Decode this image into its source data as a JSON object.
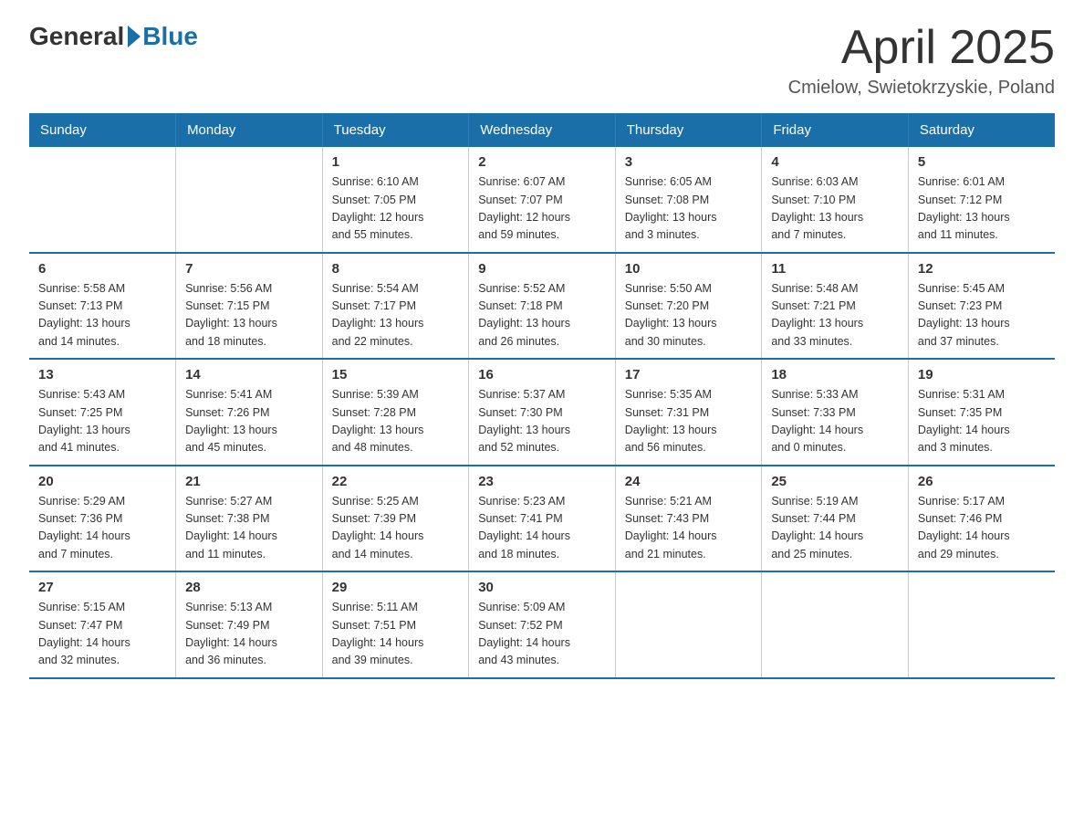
{
  "header": {
    "logo_general": "General",
    "logo_blue": "Blue",
    "month_title": "April 2025",
    "location": "Cmielow, Swietokrzyskie, Poland"
  },
  "weekdays": [
    "Sunday",
    "Monday",
    "Tuesday",
    "Wednesday",
    "Thursday",
    "Friday",
    "Saturday"
  ],
  "weeks": [
    [
      {
        "day": "",
        "info": ""
      },
      {
        "day": "",
        "info": ""
      },
      {
        "day": "1",
        "info": "Sunrise: 6:10 AM\nSunset: 7:05 PM\nDaylight: 12 hours\nand 55 minutes."
      },
      {
        "day": "2",
        "info": "Sunrise: 6:07 AM\nSunset: 7:07 PM\nDaylight: 12 hours\nand 59 minutes."
      },
      {
        "day": "3",
        "info": "Sunrise: 6:05 AM\nSunset: 7:08 PM\nDaylight: 13 hours\nand 3 minutes."
      },
      {
        "day": "4",
        "info": "Sunrise: 6:03 AM\nSunset: 7:10 PM\nDaylight: 13 hours\nand 7 minutes."
      },
      {
        "day": "5",
        "info": "Sunrise: 6:01 AM\nSunset: 7:12 PM\nDaylight: 13 hours\nand 11 minutes."
      }
    ],
    [
      {
        "day": "6",
        "info": "Sunrise: 5:58 AM\nSunset: 7:13 PM\nDaylight: 13 hours\nand 14 minutes."
      },
      {
        "day": "7",
        "info": "Sunrise: 5:56 AM\nSunset: 7:15 PM\nDaylight: 13 hours\nand 18 minutes."
      },
      {
        "day": "8",
        "info": "Sunrise: 5:54 AM\nSunset: 7:17 PM\nDaylight: 13 hours\nand 22 minutes."
      },
      {
        "day": "9",
        "info": "Sunrise: 5:52 AM\nSunset: 7:18 PM\nDaylight: 13 hours\nand 26 minutes."
      },
      {
        "day": "10",
        "info": "Sunrise: 5:50 AM\nSunset: 7:20 PM\nDaylight: 13 hours\nand 30 minutes."
      },
      {
        "day": "11",
        "info": "Sunrise: 5:48 AM\nSunset: 7:21 PM\nDaylight: 13 hours\nand 33 minutes."
      },
      {
        "day": "12",
        "info": "Sunrise: 5:45 AM\nSunset: 7:23 PM\nDaylight: 13 hours\nand 37 minutes."
      }
    ],
    [
      {
        "day": "13",
        "info": "Sunrise: 5:43 AM\nSunset: 7:25 PM\nDaylight: 13 hours\nand 41 minutes."
      },
      {
        "day": "14",
        "info": "Sunrise: 5:41 AM\nSunset: 7:26 PM\nDaylight: 13 hours\nand 45 minutes."
      },
      {
        "day": "15",
        "info": "Sunrise: 5:39 AM\nSunset: 7:28 PM\nDaylight: 13 hours\nand 48 minutes."
      },
      {
        "day": "16",
        "info": "Sunrise: 5:37 AM\nSunset: 7:30 PM\nDaylight: 13 hours\nand 52 minutes."
      },
      {
        "day": "17",
        "info": "Sunrise: 5:35 AM\nSunset: 7:31 PM\nDaylight: 13 hours\nand 56 minutes."
      },
      {
        "day": "18",
        "info": "Sunrise: 5:33 AM\nSunset: 7:33 PM\nDaylight: 14 hours\nand 0 minutes."
      },
      {
        "day": "19",
        "info": "Sunrise: 5:31 AM\nSunset: 7:35 PM\nDaylight: 14 hours\nand 3 minutes."
      }
    ],
    [
      {
        "day": "20",
        "info": "Sunrise: 5:29 AM\nSunset: 7:36 PM\nDaylight: 14 hours\nand 7 minutes."
      },
      {
        "day": "21",
        "info": "Sunrise: 5:27 AM\nSunset: 7:38 PM\nDaylight: 14 hours\nand 11 minutes."
      },
      {
        "day": "22",
        "info": "Sunrise: 5:25 AM\nSunset: 7:39 PM\nDaylight: 14 hours\nand 14 minutes."
      },
      {
        "day": "23",
        "info": "Sunrise: 5:23 AM\nSunset: 7:41 PM\nDaylight: 14 hours\nand 18 minutes."
      },
      {
        "day": "24",
        "info": "Sunrise: 5:21 AM\nSunset: 7:43 PM\nDaylight: 14 hours\nand 21 minutes."
      },
      {
        "day": "25",
        "info": "Sunrise: 5:19 AM\nSunset: 7:44 PM\nDaylight: 14 hours\nand 25 minutes."
      },
      {
        "day": "26",
        "info": "Sunrise: 5:17 AM\nSunset: 7:46 PM\nDaylight: 14 hours\nand 29 minutes."
      }
    ],
    [
      {
        "day": "27",
        "info": "Sunrise: 5:15 AM\nSunset: 7:47 PM\nDaylight: 14 hours\nand 32 minutes."
      },
      {
        "day": "28",
        "info": "Sunrise: 5:13 AM\nSunset: 7:49 PM\nDaylight: 14 hours\nand 36 minutes."
      },
      {
        "day": "29",
        "info": "Sunrise: 5:11 AM\nSunset: 7:51 PM\nDaylight: 14 hours\nand 39 minutes."
      },
      {
        "day": "30",
        "info": "Sunrise: 5:09 AM\nSunset: 7:52 PM\nDaylight: 14 hours\nand 43 minutes."
      },
      {
        "day": "",
        "info": ""
      },
      {
        "day": "",
        "info": ""
      },
      {
        "day": "",
        "info": ""
      }
    ]
  ]
}
